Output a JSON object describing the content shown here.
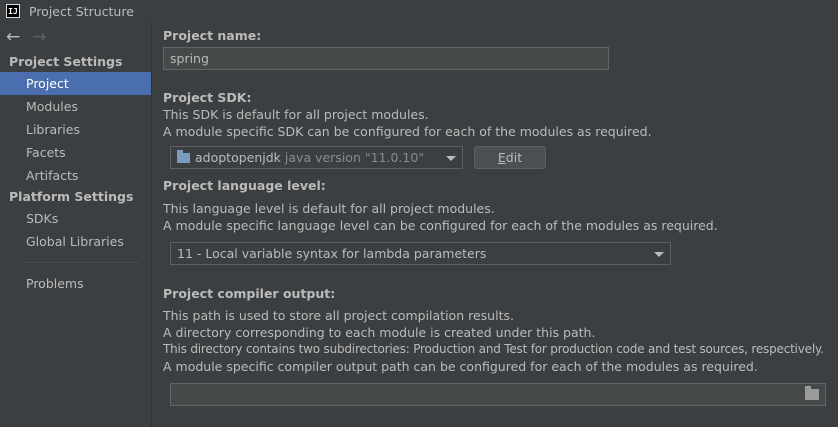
{
  "window": {
    "title": "Project Structure",
    "icon_letters": "IJ"
  },
  "nav": {
    "back_glyph": "←",
    "forward_glyph": "→"
  },
  "sidebar": {
    "project_settings_header": "Project Settings",
    "project_items": [
      {
        "label": "Project",
        "selected": true
      },
      {
        "label": "Modules"
      },
      {
        "label": "Libraries"
      },
      {
        "label": "Facets"
      },
      {
        "label": "Artifacts"
      }
    ],
    "platform_settings_header": "Platform Settings",
    "platform_items": [
      {
        "label": "SDKs"
      },
      {
        "label": "Global Libraries"
      }
    ],
    "other_items": [
      {
        "label": "Problems"
      }
    ]
  },
  "main": {
    "project_name_label": "Project name:",
    "project_name_value": "spring",
    "sdk_label": "Project SDK:",
    "sdk_desc1": "This SDK is default for all project modules.",
    "sdk_desc2": "A module specific SDK can be configured for each of the modules as required.",
    "sdk_selected_name": "adoptopenjdk",
    "sdk_selected_version": "java version \"11.0.10\"",
    "sdk_edit_button_prefix": "",
    "sdk_edit_button_mnemonic": "E",
    "sdk_edit_button_rest": "dit",
    "lang_label": "Project language level:",
    "lang_desc1": "This language level is default for all project modules.",
    "lang_desc2": "A module specific language level can be configured for each of the modules as required.",
    "lang_selected": "11 - Local variable syntax for lambda parameters",
    "compiler_label": "Project compiler output:",
    "compiler_desc1": "This path is used to store all project compilation results.",
    "compiler_desc2": "A directory corresponding to each module is created under this path.",
    "compiler_desc3": "This directory contains two subdirectories: Production and Test for production code and test sources, respectively.",
    "compiler_desc4": "A module specific compiler output path can be configured for each of the modules as required.",
    "compiler_output_value": ""
  },
  "colors": {
    "background": "#3c3f41",
    "selection": "#4b6eaf",
    "text": "#bbbbbb"
  }
}
